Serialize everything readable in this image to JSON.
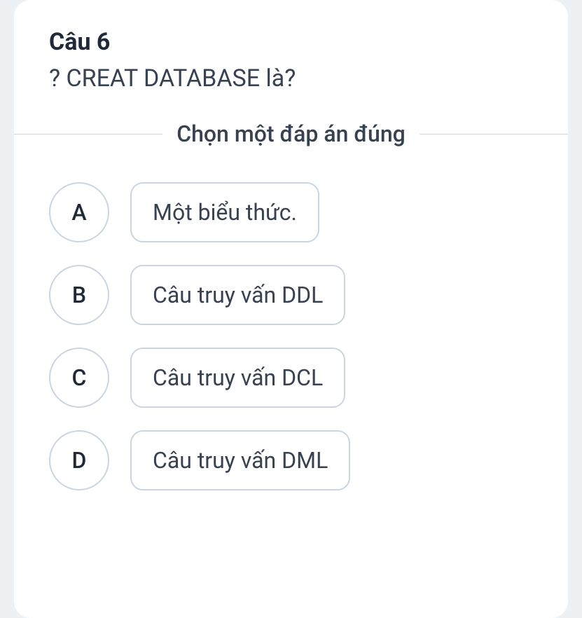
{
  "question": {
    "number": "Câu 6",
    "text": "? CREAT DATABASE là?",
    "instruction": "Chọn một đáp án đúng"
  },
  "options": [
    {
      "letter": "A",
      "text": "Một biểu thức."
    },
    {
      "letter": "B",
      "text": "Câu truy vấn DDL"
    },
    {
      "letter": "C",
      "text": "Câu truy vấn DCL"
    },
    {
      "letter": "D",
      "text": "Câu truy vấn DML"
    }
  ]
}
